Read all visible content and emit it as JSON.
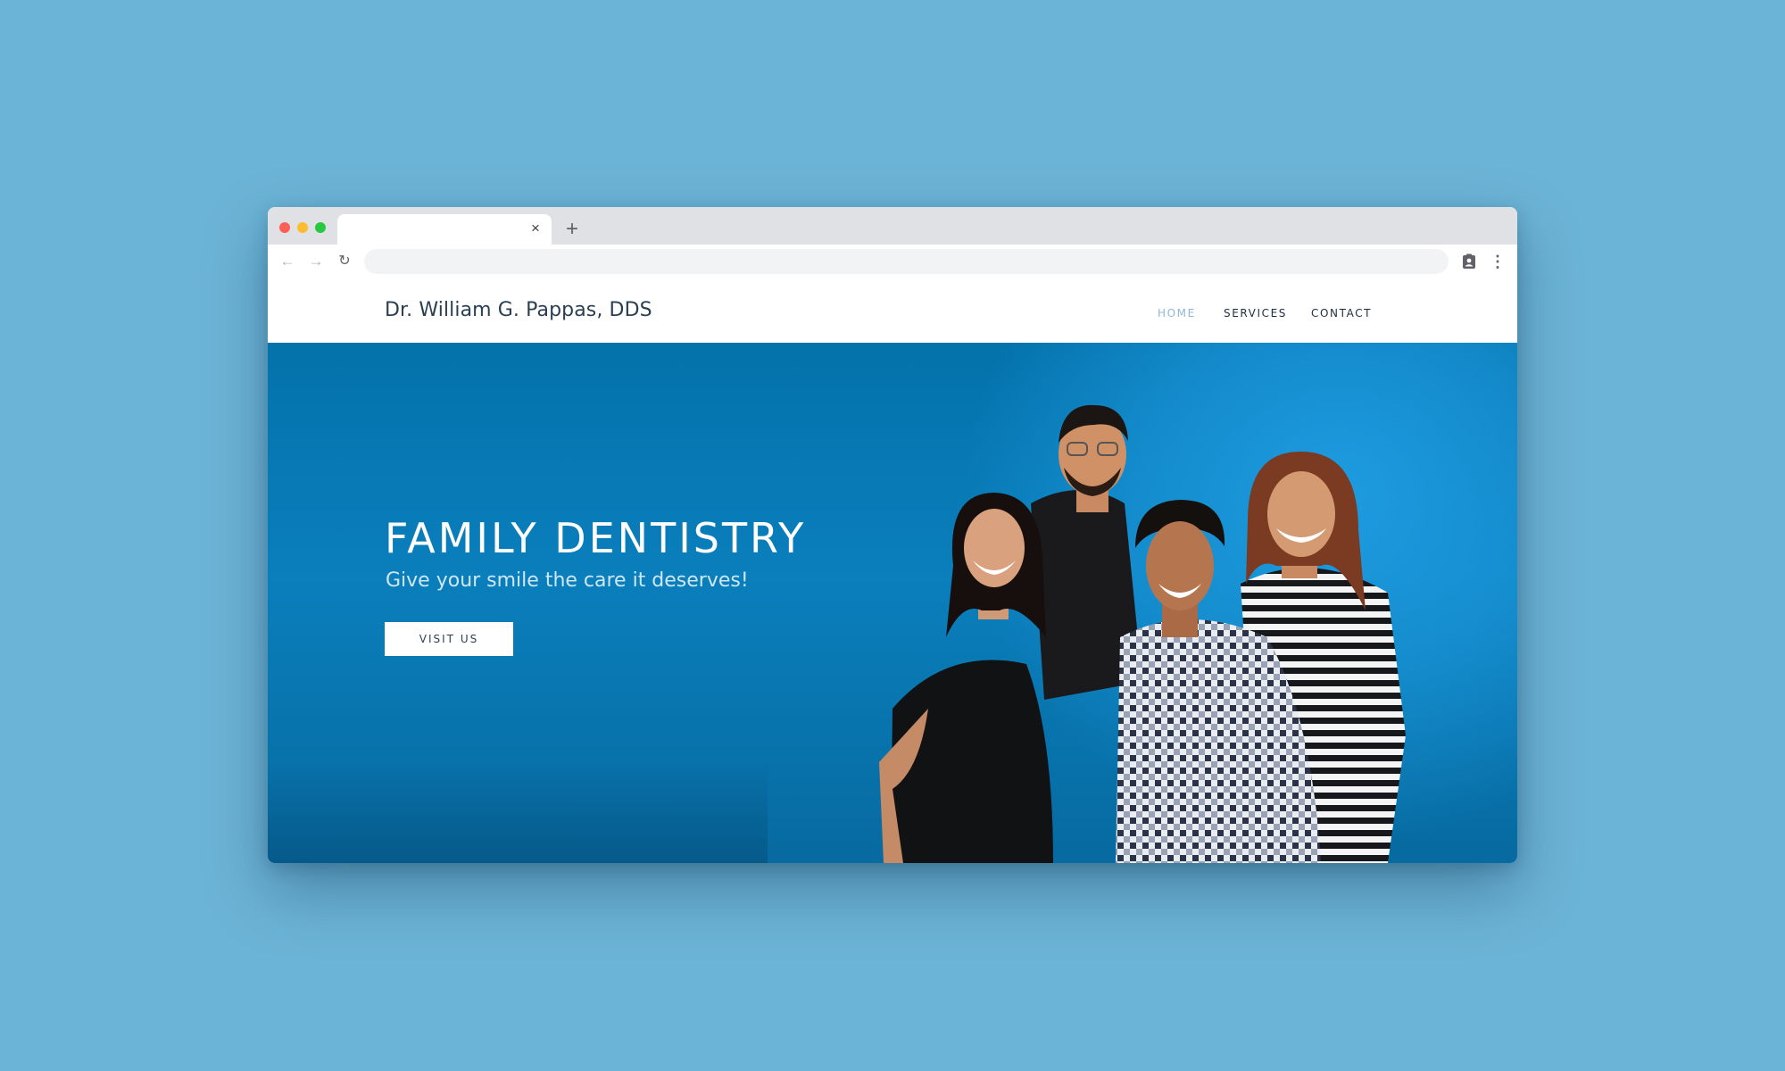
{
  "browser": {
    "tab_title": "",
    "tab_close_icon": "×",
    "new_tab_icon": "+",
    "back_icon": "←",
    "forward_icon": "→",
    "reload_icon": "↻",
    "address": "",
    "menu_icon": "⋮",
    "traffic_lights": [
      "#fe5f57",
      "#febc2e",
      "#28c840"
    ]
  },
  "site": {
    "brand": "Dr. William G. Pappas, DDS",
    "nav": [
      {
        "label": "HOME",
        "active": true
      },
      {
        "label": "SERVICES",
        "active": false
      },
      {
        "label": "CONTACT",
        "active": false
      }
    ]
  },
  "hero": {
    "title": "FAMILY DENTISTRY",
    "subtitle": "Give your smile the care it deserves!",
    "cta_label": "VISIT US",
    "image": "team-photo (four smiling people)"
  },
  "colors": {
    "page_background": "#6cb4d7",
    "hero_blue": "#0a7fbc",
    "brand_text": "#2a3f52",
    "nav_active": "#8fb8d6"
  }
}
